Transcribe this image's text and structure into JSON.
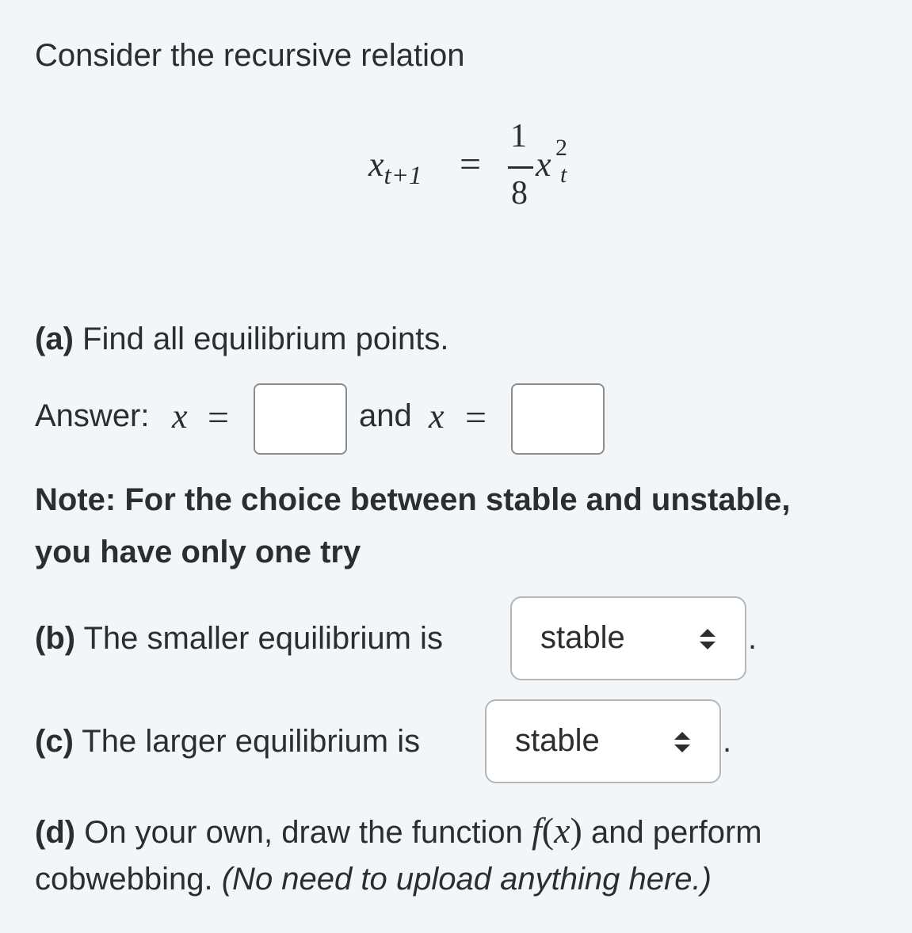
{
  "intro": "Consider the recursive relation",
  "equation": {
    "lhs_var": "x",
    "lhs_sub": "t+1",
    "equals": "=",
    "frac_num": "1",
    "frac_den": "8",
    "rhs_var": "x",
    "rhs_sup": "2",
    "rhs_sub": "t"
  },
  "part_a": {
    "label": "(a)",
    "text": "Find all equilibrium points.",
    "answer_prefix": "Answer:",
    "var": "x",
    "equals": "=",
    "and_text": "and",
    "input1_value": "",
    "input2_value": ""
  },
  "note": {
    "line1": "Note: For the choice between stable and unstable,",
    "line2": "you have only one try"
  },
  "part_b": {
    "label": "(b)",
    "text": "The smaller equilibrium is",
    "selected": "stable",
    "period": "."
  },
  "part_c": {
    "label": "(c)",
    "text": "The larger equilibrium is",
    "selected": "stable",
    "period": "."
  },
  "part_d": {
    "label": "(d)",
    "text1": "On your own, draw the function",
    "func": "f",
    "paren_open": "(",
    "func_var": "x",
    "paren_close": ")",
    "text2": "and perform",
    "line2_plain": "cobwebbing.",
    "line2_italic": "(No need to upload anything here.)"
  }
}
